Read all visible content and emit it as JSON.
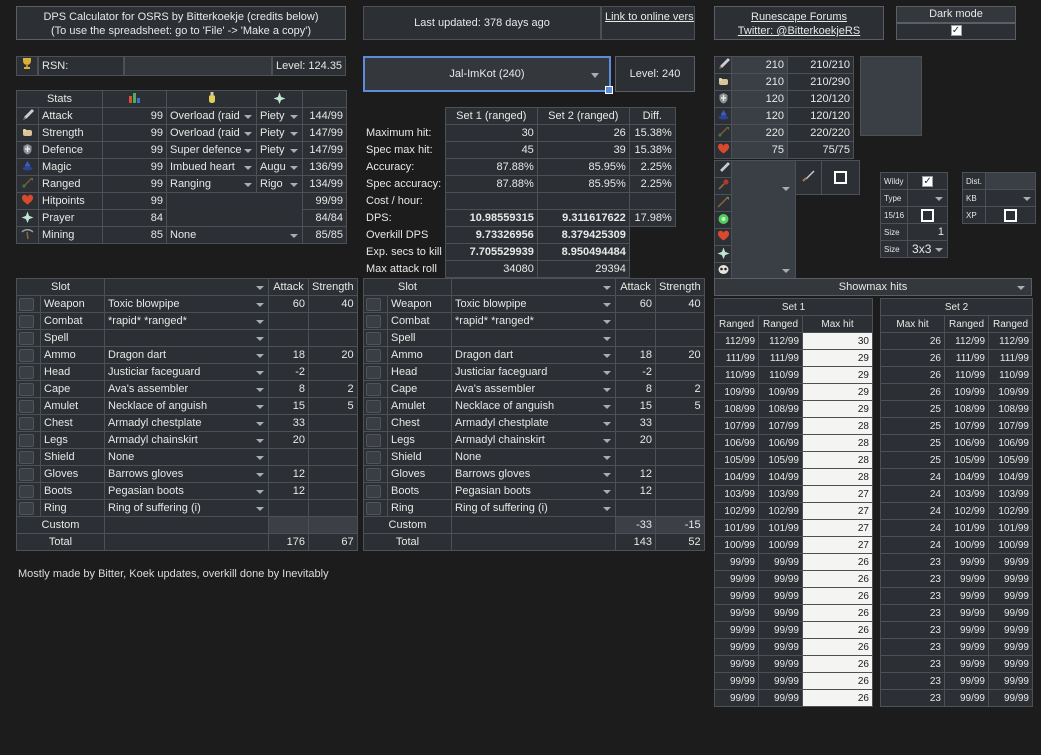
{
  "app": {
    "title_line1": "DPS Calculator for OSRS by Bitterkoekje (credits below)",
    "title_line2": "(To use the spreadsheet:  go to 'File' -> 'Make a copy')",
    "credits": "Mostly made by Bitter, Koek updates, overkill done by Inevitably",
    "last_updated": "Last updated: 378 days ago",
    "online_link": "Link to online version",
    "forums_link": "Runescape Forums",
    "twitter_link": "Twitter: @BitterkoekjeRS",
    "dark_mode_label": "Dark mode",
    "dark_mode_checked": "✓",
    "accent_color": "#5b8ddb"
  },
  "rsn": {
    "icon": "trophy-icon",
    "label": "RSN:",
    "value": "",
    "placeholder": "",
    "level_label": "Level: 124.35"
  },
  "stats": {
    "header": {
      "name": "Stats",
      "level_icon": "barchart-icon",
      "boost_icon": "potion-icon",
      "prayer_icon": "prayer-icon",
      "total": ""
    },
    "rows": [
      {
        "icon": "attack-icon",
        "name": "Attack",
        "level": "99",
        "boost": "Overload (raid",
        "prayer": "Piety",
        "total": "144/99"
      },
      {
        "icon": "strength-icon",
        "name": "Strength",
        "level": "99",
        "boost": "Overload (raid",
        "prayer": "Piety",
        "total": "147/99"
      },
      {
        "icon": "defence-icon",
        "name": "Defence",
        "level": "99",
        "boost": "Super defence",
        "prayer": "Piety",
        "total": "147/99"
      },
      {
        "icon": "magic-icon",
        "name": "Magic",
        "level": "99",
        "boost": "Imbued heart",
        "prayer": "Augu",
        "total": "136/99"
      },
      {
        "icon": "ranged-icon",
        "name": "Ranged",
        "level": "99",
        "boost": "Ranging",
        "prayer": "Rigo",
        "total": "134/99"
      },
      {
        "icon": "hitpoints-icon",
        "name": "Hitpoints",
        "level": "99",
        "boost": "",
        "prayer": "",
        "total": "99/99"
      },
      {
        "icon": "prayer-icon",
        "name": "Prayer",
        "level": "84",
        "boost": "",
        "prayer": "",
        "total": "84/84"
      },
      {
        "icon": "mining-icon",
        "name": "Mining",
        "level": "85",
        "boost": "None",
        "prayer": "",
        "total": "85/85"
      }
    ]
  },
  "npc": {
    "selected": "Jal-ImKot (240)",
    "level_label": "Level: 240"
  },
  "results": {
    "columns": [
      "",
      "Set 1 (ranged)",
      "Set 2 (ranged)",
      "Diff."
    ],
    "rows": [
      {
        "label": "Maximum hit:",
        "set1": "30",
        "set2": "26",
        "diff": "15.38%",
        "bold": false
      },
      {
        "label": "Spec max hit:",
        "set1": "45",
        "set2": "39",
        "diff": "15.38%",
        "bold": false
      },
      {
        "label": "Accuracy:",
        "set1": "87.88%",
        "set2": "85.95%",
        "diff": "2.25%",
        "bold": false
      },
      {
        "label": "Spec accuracy:",
        "set1": "87.88%",
        "set2": "85.95%",
        "diff": "2.25%",
        "bold": false
      },
      {
        "label": "Cost / hour:",
        "set1": "",
        "set2": "",
        "diff": "",
        "bold": false
      },
      {
        "label": "DPS:",
        "set1": "10.98559315",
        "set2": "9.311617622",
        "diff": "17.98%",
        "bold": true
      }
    ],
    "extra_rows": [
      {
        "label": "Overkill DPS",
        "set1": "9.73326956",
        "set2": "8.379425309",
        "bold": true
      },
      {
        "label": "Exp. secs to kill",
        "set1": "7.705529939",
        "set2": "8.950494484",
        "bold": true
      },
      {
        "label": "Max attack roll",
        "set1": "34080",
        "set2": "29394",
        "bold": false
      }
    ]
  },
  "gear": {
    "columns": [
      "Slot",
      "",
      "Attack",
      "Strength"
    ],
    "set1": {
      "rows": [
        {
          "icon": "weapon-icon",
          "slot": "Weapon",
          "item": "Toxic blowpipe",
          "attack": "60",
          "strength": "40"
        },
        {
          "icon": "combat-icon",
          "slot": "Combat",
          "item": "*rapid* *ranged*",
          "attack": "",
          "strength": ""
        },
        {
          "icon": "spell-icon",
          "slot": "Spell",
          "item": "",
          "attack": "",
          "strength": ""
        },
        {
          "icon": "ammo-icon",
          "slot": "Ammo",
          "item": "Dragon dart",
          "attack": "18",
          "strength": "20"
        },
        {
          "icon": "head-icon",
          "slot": "Head",
          "item": "Justiciar faceguard",
          "attack": "-2",
          "strength": ""
        },
        {
          "icon": "cape-icon",
          "slot": "Cape",
          "item": "Ava's assembler",
          "attack": "8",
          "strength": "2"
        },
        {
          "icon": "amulet-icon",
          "slot": "Amulet",
          "item": "Necklace of anguish",
          "attack": "15",
          "strength": "5"
        },
        {
          "icon": "chest-icon",
          "slot": "Chest",
          "item": "Armadyl chestplate",
          "attack": "33",
          "strength": ""
        },
        {
          "icon": "legs-icon",
          "slot": "Legs",
          "item": "Armadyl chainskirt",
          "attack": "20",
          "strength": ""
        },
        {
          "icon": "shield-icon",
          "slot": "Shield",
          "item": "None",
          "attack": "",
          "strength": ""
        },
        {
          "icon": "gloves-icon",
          "slot": "Gloves",
          "item": "Barrows gloves",
          "attack": "12",
          "strength": ""
        },
        {
          "icon": "boots-icon",
          "slot": "Boots",
          "item": "Pegasian boots",
          "attack": "12",
          "strength": ""
        },
        {
          "icon": "ring-icon",
          "slot": "Ring",
          "item": "Ring of suffering (i)",
          "attack": "",
          "strength": ""
        }
      ],
      "custom": {
        "label": "Custom",
        "attack": "",
        "strength": ""
      },
      "total": {
        "label": "Total",
        "attack": "176",
        "strength": "67"
      }
    },
    "set2": {
      "rows": [
        {
          "icon": "weapon-icon",
          "slot": "Weapon",
          "item": "Toxic blowpipe",
          "attack": "60",
          "strength": "40"
        },
        {
          "icon": "combat-icon",
          "slot": "Combat",
          "item": "*rapid* *ranged*",
          "attack": "",
          "strength": ""
        },
        {
          "icon": "spell-icon",
          "slot": "Spell",
          "item": "",
          "attack": "",
          "strength": ""
        },
        {
          "icon": "ammo-icon",
          "slot": "Ammo",
          "item": "Dragon dart",
          "attack": "18",
          "strength": "20"
        },
        {
          "icon": "head-icon",
          "slot": "Head",
          "item": "Justiciar faceguard",
          "attack": "-2",
          "strength": ""
        },
        {
          "icon": "cape-icon",
          "slot": "Cape",
          "item": "Ava's assembler",
          "attack": "8",
          "strength": "2"
        },
        {
          "icon": "amulet-icon",
          "slot": "Amulet",
          "item": "Necklace of anguish",
          "attack": "15",
          "strength": "5"
        },
        {
          "icon": "chest-icon",
          "slot": "Chest",
          "item": "Armadyl chestplate",
          "attack": "33",
          "strength": ""
        },
        {
          "icon": "legs-icon",
          "slot": "Legs",
          "item": "Armadyl chainskirt",
          "attack": "20",
          "strength": ""
        },
        {
          "icon": "shield-icon",
          "slot": "Shield",
          "item": "None",
          "attack": "",
          "strength": ""
        },
        {
          "icon": "gloves-icon",
          "slot": "Gloves",
          "item": "Barrows gloves",
          "attack": "12",
          "strength": ""
        },
        {
          "icon": "boots-icon",
          "slot": "Boots",
          "item": "Pegasian boots",
          "attack": "12",
          "strength": ""
        },
        {
          "icon": "ring-icon",
          "slot": "Ring",
          "item": "Ring of suffering (i)",
          "attack": "",
          "strength": ""
        }
      ],
      "custom": {
        "label": "Custom",
        "attack": "-33",
        "strength": "-15"
      },
      "total": {
        "label": "Total",
        "attack": "143",
        "strength": "52"
      }
    }
  },
  "npc_stats": {
    "rows": [
      {
        "icon": "attack-icon",
        "value": "210",
        "ratio": "210/210"
      },
      {
        "icon": "strength-icon",
        "value": "210",
        "ratio": "210/290"
      },
      {
        "icon": "defence-icon",
        "value": "120",
        "ratio": "120/120"
      },
      {
        "icon": "magic-icon",
        "value": "120",
        "ratio": "120/120"
      },
      {
        "icon": "ranged-icon",
        "value": "220",
        "ratio": "220/220"
      },
      {
        "icon": "hitpoints-icon",
        "value": "75",
        "ratio": "75/75"
      }
    ],
    "secondary_icons": [
      "dagger-icon",
      "mace-icon",
      "arrow-icon",
      "green-orb-icon",
      "hitpoints-icon",
      "prayer-icon",
      "skull-icon"
    ],
    "spec_icon": "spec-weapon-icon",
    "spec_checked": false
  },
  "options": {
    "wildy": {
      "label": "Wildy",
      "value": "✓",
      "type": "checkbox"
    },
    "type": {
      "label": "Type",
      "value": "",
      "type": "dropdown"
    },
    "fifteen_sixteen": {
      "label": "15/16",
      "value": "",
      "type": "checkbox"
    },
    "size_num": {
      "label": "Size",
      "value": "1",
      "type": "number"
    },
    "size_dim": {
      "label": "Size",
      "value": "3x3",
      "type": "dropdown"
    },
    "dist": {
      "label": "Dist.",
      "value": "",
      "type": "text"
    },
    "kb": {
      "label": "KB",
      "value": "",
      "type": "dropdown"
    },
    "xp": {
      "label": "XP",
      "value": "",
      "type": "checkbox"
    }
  },
  "showmax": {
    "title": "Showmax hits",
    "set1_label": "Set 1",
    "set2_label": "Set 2",
    "set1_columns": [
      "Ranged",
      "Ranged",
      "Max hit"
    ],
    "set2_columns": [
      "Max hit",
      "Ranged",
      "Ranged"
    ],
    "rows": [
      {
        "s1a": "112/99",
        "s1b": "112/99",
        "max1": "30",
        "max2": "26",
        "s2a": "112/99",
        "s2b": "112/99"
      },
      {
        "s1a": "111/99",
        "s1b": "111/99",
        "max1": "29",
        "max2": "26",
        "s2a": "111/99",
        "s2b": "111/99"
      },
      {
        "s1a": "110/99",
        "s1b": "110/99",
        "max1": "29",
        "max2": "26",
        "s2a": "110/99",
        "s2b": "110/99"
      },
      {
        "s1a": "109/99",
        "s1b": "109/99",
        "max1": "29",
        "max2": "26",
        "s2a": "109/99",
        "s2b": "109/99"
      },
      {
        "s1a": "108/99",
        "s1b": "108/99",
        "max1": "29",
        "max2": "25",
        "s2a": "108/99",
        "s2b": "108/99"
      },
      {
        "s1a": "107/99",
        "s1b": "107/99",
        "max1": "28",
        "max2": "25",
        "s2a": "107/99",
        "s2b": "107/99"
      },
      {
        "s1a": "106/99",
        "s1b": "106/99",
        "max1": "28",
        "max2": "25",
        "s2a": "106/99",
        "s2b": "106/99"
      },
      {
        "s1a": "105/99",
        "s1b": "105/99",
        "max1": "28",
        "max2": "25",
        "s2a": "105/99",
        "s2b": "105/99"
      },
      {
        "s1a": "104/99",
        "s1b": "104/99",
        "max1": "28",
        "max2": "24",
        "s2a": "104/99",
        "s2b": "104/99"
      },
      {
        "s1a": "103/99",
        "s1b": "103/99",
        "max1": "27",
        "max2": "24",
        "s2a": "103/99",
        "s2b": "103/99"
      },
      {
        "s1a": "102/99",
        "s1b": "102/99",
        "max1": "27",
        "max2": "24",
        "s2a": "102/99",
        "s2b": "102/99"
      },
      {
        "s1a": "101/99",
        "s1b": "101/99",
        "max1": "27",
        "max2": "24",
        "s2a": "101/99",
        "s2b": "101/99"
      },
      {
        "s1a": "100/99",
        "s1b": "100/99",
        "max1": "27",
        "max2": "24",
        "s2a": "100/99",
        "s2b": "100/99"
      },
      {
        "s1a": "99/99",
        "s1b": "99/99",
        "max1": "26",
        "max2": "23",
        "s2a": "99/99",
        "s2b": "99/99"
      },
      {
        "s1a": "99/99",
        "s1b": "99/99",
        "max1": "26",
        "max2": "23",
        "s2a": "99/99",
        "s2b": "99/99"
      },
      {
        "s1a": "99/99",
        "s1b": "99/99",
        "max1": "26",
        "max2": "23",
        "s2a": "99/99",
        "s2b": "99/99"
      },
      {
        "s1a": "99/99",
        "s1b": "99/99",
        "max1": "26",
        "max2": "23",
        "s2a": "99/99",
        "s2b": "99/99"
      },
      {
        "s1a": "99/99",
        "s1b": "99/99",
        "max1": "26",
        "max2": "23",
        "s2a": "99/99",
        "s2b": "99/99"
      },
      {
        "s1a": "99/99",
        "s1b": "99/99",
        "max1": "26",
        "max2": "23",
        "s2a": "99/99",
        "s2b": "99/99"
      },
      {
        "s1a": "99/99",
        "s1b": "99/99",
        "max1": "26",
        "max2": "23",
        "s2a": "99/99",
        "s2b": "99/99"
      },
      {
        "s1a": "99/99",
        "s1b": "99/99",
        "max1": "26",
        "max2": "23",
        "s2a": "99/99",
        "s2b": "99/99"
      },
      {
        "s1a": "99/99",
        "s1b": "99/99",
        "max1": "26",
        "max2": "23",
        "s2a": "99/99",
        "s2b": "99/99"
      }
    ]
  }
}
